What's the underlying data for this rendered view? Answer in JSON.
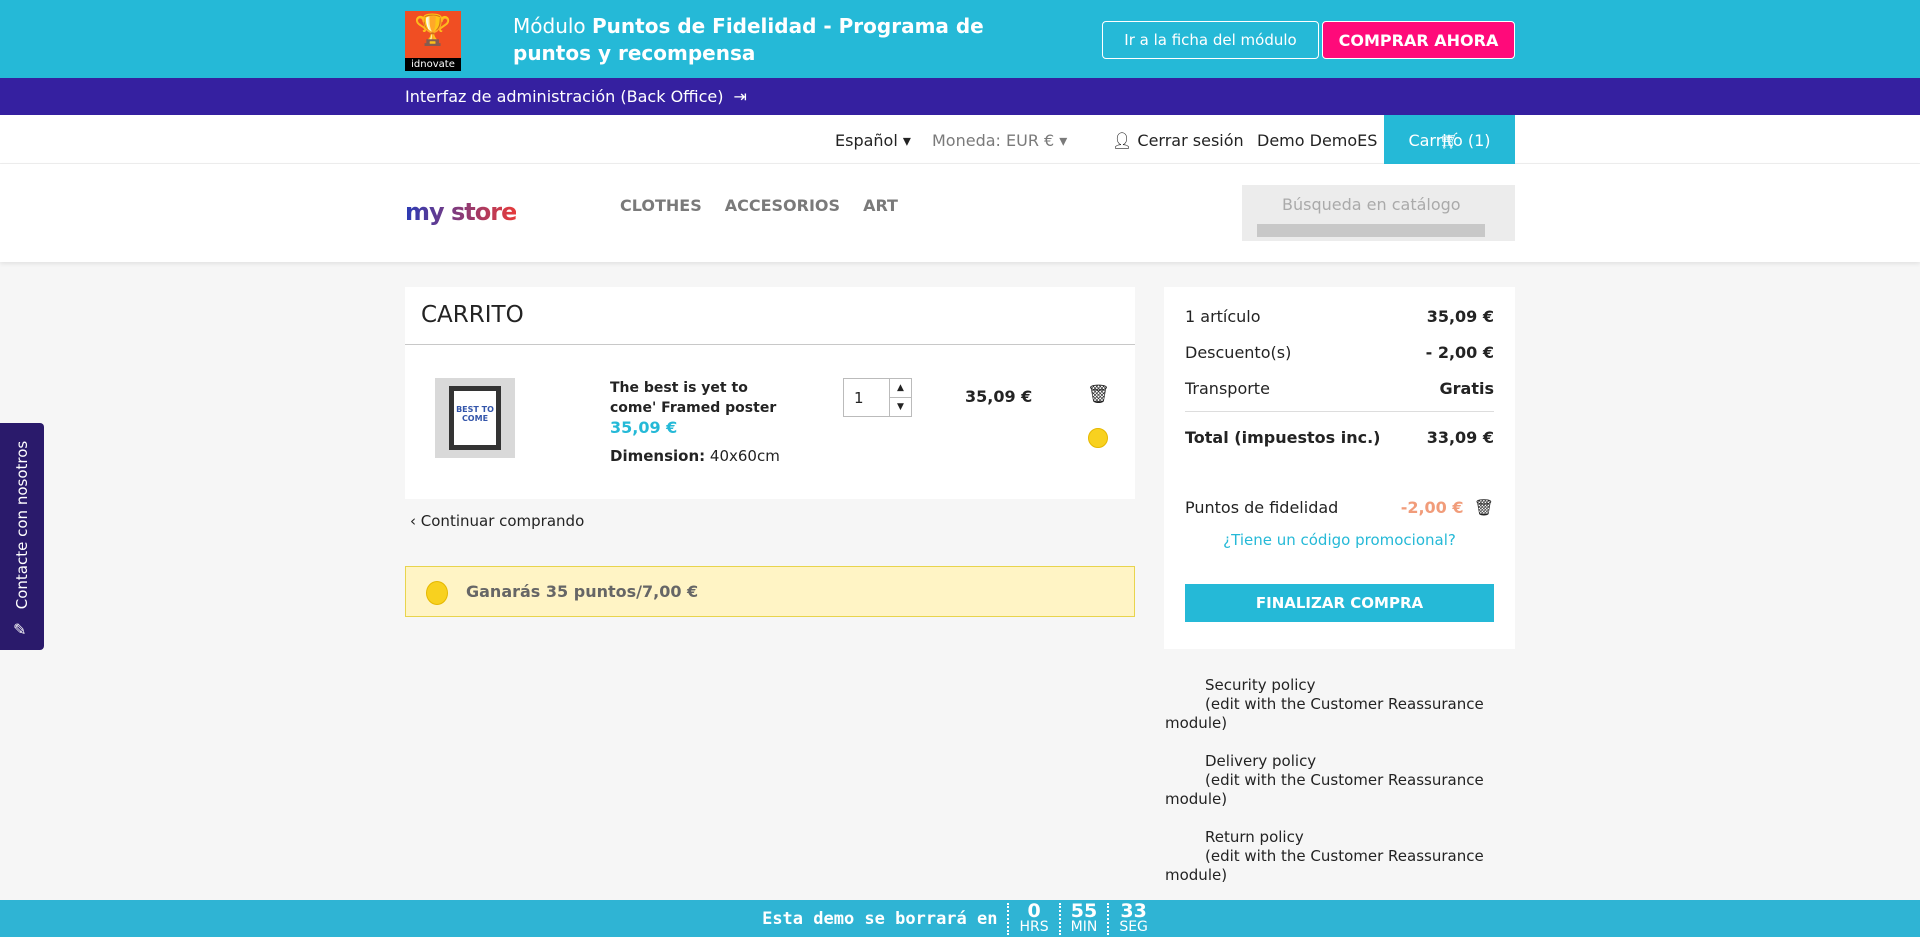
{
  "topbar": {
    "logo_text": "idnovate",
    "title_prefix": "Módulo ",
    "title_bold": "Puntos de Fidelidad - Programa de puntos y recompensa",
    "module_button": "Ir a la ficha del módulo",
    "buy_button": "COMPRAR AHORA"
  },
  "admin": {
    "label": "Interfaz de administración (Back Office)"
  },
  "nav": {
    "language": "Español",
    "currency": "Moneda: EUR €",
    "logout": "Cerrar sesión",
    "user": "Demo DemoES",
    "cart": "Carrito (1)"
  },
  "header": {
    "logo": "my store",
    "menu": [
      "CLOTHES",
      "ACCESORIOS",
      "ART"
    ],
    "search_placeholder": "Búsqueda en catálogo"
  },
  "cart": {
    "title": "CARRITO",
    "product": {
      "name": "The best is yet to come' Framed poster",
      "price": "35,09 €",
      "dim_label": "Dimension:",
      "dim_value": "40x60cm",
      "qty": "1",
      "total": "35,09 €",
      "thumb_text": "BEST TO COME"
    },
    "continue": "Continuar comprando",
    "earn": "Ganarás 35 puntos/7,00 €"
  },
  "summary": {
    "items_label": "1 artículo",
    "items_value": "35,09 €",
    "discount_label": "Descuento(s)",
    "discount_value": "- 2,00 €",
    "shipping_label": "Transporte",
    "shipping_value": "Gratis",
    "total_label": "Total (impuestos inc.)",
    "total_value": "33,09 €",
    "points_label": "Puntos de fidelidad",
    "points_value": "-2,00 €",
    "promo": "¿Tiene un código promocional?",
    "checkout": "FINALIZAR COMPRA"
  },
  "reassurance": [
    {
      "title": "Security policy",
      "desc": "(edit with the Customer Reassurance module)"
    },
    {
      "title": "Delivery policy",
      "desc": "(edit with the Customer Reassurance module)"
    },
    {
      "title": "Return policy",
      "desc": "(edit with the Customer Reassurance module)"
    }
  ],
  "contact": "Contacte con nosotros",
  "countdown": {
    "message": "Esta demo se borrará en",
    "hours": "0",
    "hours_label": "HRS",
    "minutes": "55",
    "minutes_label": "MIN",
    "seconds": "33",
    "seconds_label": "SEG"
  }
}
